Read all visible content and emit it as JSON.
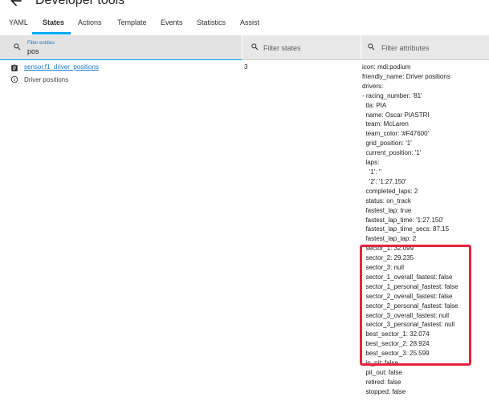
{
  "header": {
    "title": "Developer tools"
  },
  "tabs": [
    {
      "label": "YAML"
    },
    {
      "label": "States",
      "active": true
    },
    {
      "label": "Actions"
    },
    {
      "label": "Template"
    },
    {
      "label": "Events"
    },
    {
      "label": "Statistics"
    },
    {
      "label": "Assist"
    }
  ],
  "filters": {
    "entities": {
      "label": "Filter entities",
      "value": "pos"
    },
    "states": {
      "placeholder": "Filter states"
    },
    "attributes": {
      "placeholder": "Filter attributes"
    }
  },
  "entity": {
    "id": "sensor.f1_driver_positions",
    "friendly": "Driver positions",
    "state": "3",
    "icon": "clipboard-list-icon"
  },
  "attributes": [
    "icon: mdi:podium",
    "friendly_name: Driver positions",
    "drivers:",
    "- racing_number: '81'",
    "  tla: PIA",
    "  name: Oscar PIASTRI",
    "  team: McLaren",
    "  team_color: '#F47600'",
    "  grid_position: '1'",
    "  current_position: '1'",
    "  laps:",
    "    '1': ''",
    "    '2': '1:27.150'",
    "  completed_laps: 2",
    "  status: on_track",
    "  fastest_lap: true",
    "  fastest_lap_time: '1:27.150'",
    "  fastest_lap_time_secs: 87.15",
    "  fastest_lap_lap: 2",
    "  sector_1: 32.099",
    "  sector_2: 29.235",
    "  sector_3: null",
    "  sector_1_overall_fastest: false",
    "  sector_1_personal_fastest: false",
    "  sector_2_overall_fastest: false",
    "  sector_2_personal_fastest: false",
    "  sector_3_overall_fastest: null",
    "  sector_3_personal_fastest: null",
    "  best_sector_1: 32.074",
    "  best_sector_2: 28.924",
    "  best_sector_3: 25.599",
    "  in_pit: false",
    "  pit_out: false",
    "  retired: false",
    "  stopped: false"
  ],
  "colors": {
    "accent": "#03a9f4",
    "link": "#1976d2",
    "highlight": "#e6253b"
  }
}
